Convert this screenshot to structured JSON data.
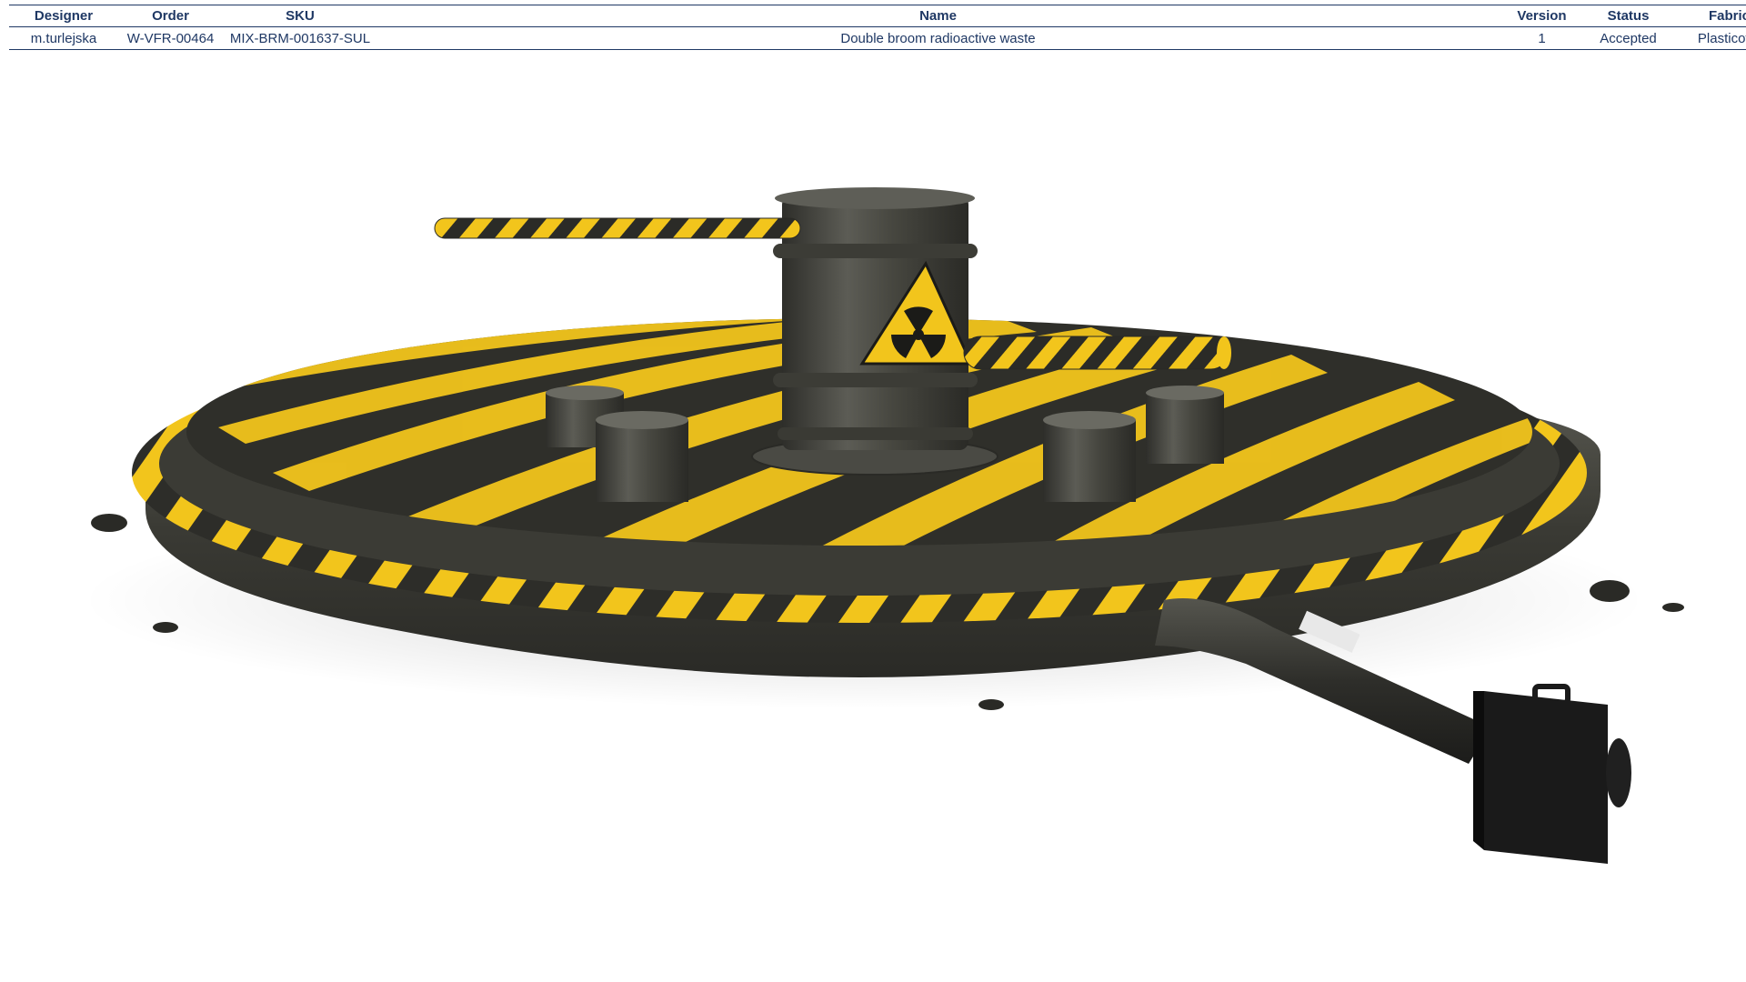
{
  "table": {
    "headers": {
      "designer": "Designer",
      "order": "Order",
      "sku": "SKU",
      "name": "Name",
      "version": "Version",
      "status": "Status",
      "fabric": "Fabric"
    },
    "row": {
      "designer": "m.turlejska",
      "order": "W-VFR-00464",
      "sku": "MIX-BRM-001637-SUL",
      "name": "Double broom radioactive waste",
      "version": "1",
      "status": "Accepted",
      "fabric": "Plasticotta"
    }
  },
  "render": {
    "colors": {
      "hazard_yellow": "#f2c51c",
      "tube_dark": "#3a3a35",
      "barrel": "#4a4a44",
      "blower": "#151515"
    },
    "icons": [
      "radiation-icon"
    ]
  }
}
